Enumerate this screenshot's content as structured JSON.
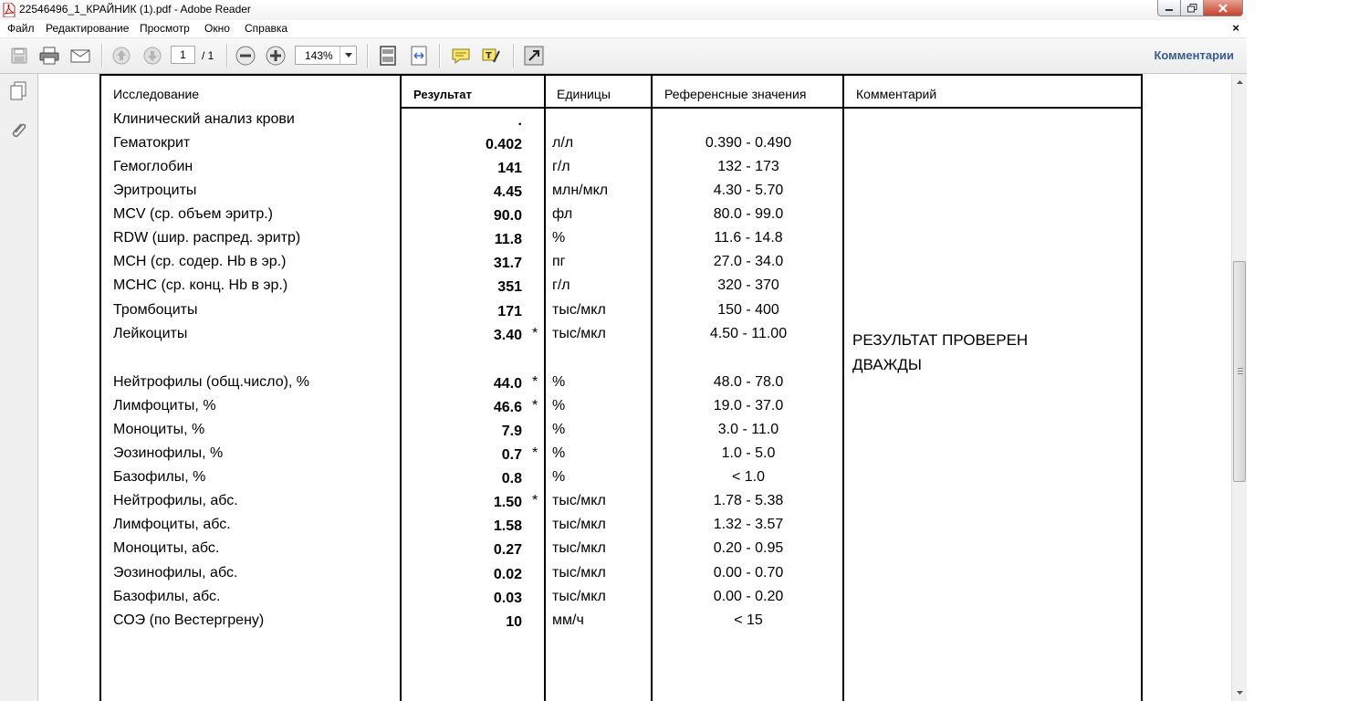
{
  "window": {
    "title": "22546496_1_КРАЙНИК (1).pdf - Adobe Reader",
    "close_doc_symbol": "×"
  },
  "menu": [
    "Файл",
    "Редактирование",
    "Просмотр",
    "Окно",
    "Справка"
  ],
  "toolbar": {
    "page_current": "1",
    "page_total": "/ 1",
    "zoom": "143%",
    "comments_label": "Комментарии"
  },
  "table": {
    "headers": {
      "study": "Исследование",
      "result": "Результат",
      "units": "Единицы",
      "reference": "Референсные значения",
      "comment": "Комментарий"
    },
    "rows": [
      {
        "name": "Клинический анализ крови",
        "value": ".",
        "flag": "",
        "unit": "",
        "ref": ""
      },
      {
        "name": "Гематокрит",
        "value": "0.402",
        "flag": "",
        "unit": "л/л",
        "ref": "0.390 - 0.490"
      },
      {
        "name": "Гемоглобин",
        "value": "141",
        "flag": "",
        "unit": "г/л",
        "ref": "132 - 173"
      },
      {
        "name": "Эритроциты",
        "value": "4.45",
        "flag": "",
        "unit": "млн/мкл",
        "ref": "4.30 - 5.70"
      },
      {
        "name": "MCV (ср. объем эритр.)",
        "value": "90.0",
        "flag": "",
        "unit": "фл",
        "ref": "80.0 - 99.0"
      },
      {
        "name": "RDW (шир. распред. эритр)",
        "value": "11.8",
        "flag": "",
        "unit": "%",
        "ref": "11.6 - 14.8"
      },
      {
        "name": "MCH (ср. содер. Hb в эр.)",
        "value": "31.7",
        "flag": "",
        "unit": "пг",
        "ref": "27.0 - 34.0"
      },
      {
        "name": "MCHC (ср. конц. Hb в эр.)",
        "value": "351",
        "flag": "",
        "unit": "г/л",
        "ref": "320 - 370"
      },
      {
        "name": "Тромбоциты",
        "value": "171",
        "flag": "",
        "unit": "тыс/мкл",
        "ref": "150 - 400"
      },
      {
        "name": "Лейкоциты",
        "value": "3.40",
        "flag": "*",
        "unit": "тыс/мкл",
        "ref": "4.50 - 11.00"
      },
      {
        "name": "Нейтрофилы (общ.число), %",
        "value": "44.0",
        "flag": "*",
        "unit": "%",
        "ref": "48.0 - 78.0"
      },
      {
        "name": "Лимфоциты, %",
        "value": "46.6",
        "flag": "*",
        "unit": "%",
        "ref": "19.0 - 37.0"
      },
      {
        "name": "Моноциты, %",
        "value": "7.9",
        "flag": "",
        "unit": "%",
        "ref": "3.0 - 11.0"
      },
      {
        "name": "Эозинофилы, %",
        "value": "0.7",
        "flag": "*",
        "unit": "%",
        "ref": "1.0 - 5.0"
      },
      {
        "name": "Базофилы, %",
        "value": "0.8",
        "flag": "",
        "unit": "%",
        "ref": "< 1.0"
      },
      {
        "name": "Нейтрофилы, абс.",
        "value": "1.50",
        "flag": "*",
        "unit": "тыс/мкл",
        "ref": "1.78 - 5.38"
      },
      {
        "name": "Лимфоциты, абс.",
        "value": "1.58",
        "flag": "",
        "unit": "тыс/мкл",
        "ref": "1.32 - 3.57"
      },
      {
        "name": "Моноциты, абс.",
        "value": "0.27",
        "flag": "",
        "unit": "тыс/мкл",
        "ref": "0.20 - 0.95"
      },
      {
        "name": "Эозинофилы, абс.",
        "value": "0.02",
        "flag": "",
        "unit": "тыс/мкл",
        "ref": "0.00 - 0.70"
      },
      {
        "name": "Базофилы, абс.",
        "value": "0.03",
        "flag": "",
        "unit": "тыс/мкл",
        "ref": "0.00 - 0.20"
      },
      {
        "name": "СОЭ (по Вестергрену)",
        "value": "10",
        "flag": "",
        "unit": "мм/ч",
        "ref": "< 15"
      }
    ],
    "comment_line1": "РЕЗУЛЬТАТ ПРОВЕРЕН",
    "comment_line2": "ДВАЖДЫ"
  },
  "icons": {
    "save": "save-icon",
    "print": "print-icon",
    "email": "email-icon",
    "prev": "page-up-icon",
    "next": "page-down-icon",
    "zoom_out": "zoom-out-icon",
    "zoom_in": "zoom-in-icon",
    "fit_page": "fit-page-icon",
    "fit_width": "fit-width-icon",
    "comment": "sticky-note-icon",
    "highlight": "highlight-icon",
    "expand": "expand-icon",
    "pages": "pages-panel-icon",
    "attach": "attachment-icon"
  },
  "colors": {
    "comments_link": "#3a5d8f",
    "close_button": "#c7432d"
  }
}
